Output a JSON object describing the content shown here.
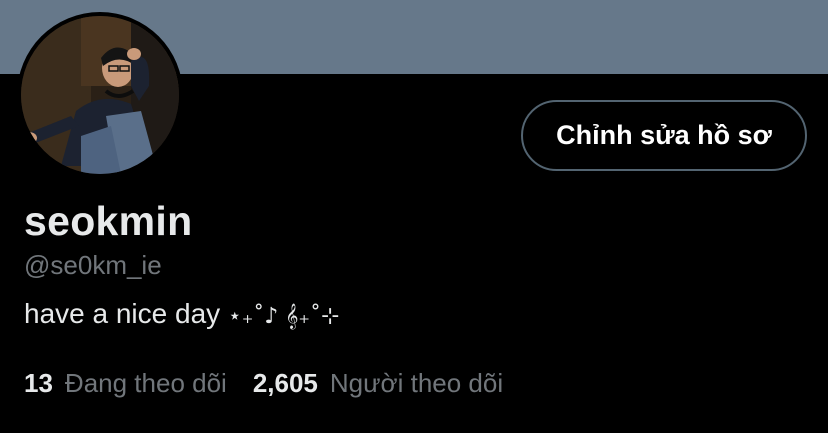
{
  "header": {
    "banner_color": "#66788a"
  },
  "profile": {
    "avatar": "avatar",
    "edit_button_label": "Chỉnh sửa hồ sơ",
    "display_name": "seokmin",
    "handle": "@se0km_ie",
    "bio_text": "have a nice day ",
    "bio_decoration": "⋆₊˚♪ 𝄞₊˚⊹"
  },
  "stats": {
    "following_count": "13",
    "following_label": "Đang theo dõi",
    "followers_count": "2,605",
    "followers_label": "Người theo dõi"
  },
  "colors": {
    "background": "#000000",
    "primary_text": "#e7e9ea",
    "secondary_text": "#71767b",
    "button_border": "#536471"
  }
}
